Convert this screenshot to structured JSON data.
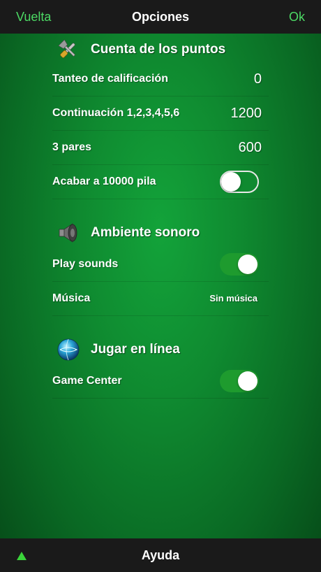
{
  "navbar": {
    "back_label": "Vuelta",
    "title": "Opciones",
    "ok_label": "Ok"
  },
  "sections": {
    "scoring": {
      "title": "Cuenta de los puntos",
      "icon": "tools-icon",
      "rows": [
        {
          "label": "Tanteo de calificación",
          "value": "0"
        },
        {
          "label": "Continuación 1,2,3,4,5,6",
          "value": "1200"
        },
        {
          "label": "3 pares",
          "value": "600"
        },
        {
          "label": "Acabar a 10000 pila",
          "toggle": false
        }
      ]
    },
    "sound": {
      "title": "Ambiente sonoro",
      "icon": "speaker-icon",
      "rows": [
        {
          "label": "Play sounds",
          "toggle": true
        },
        {
          "label": "Música",
          "value": "Sin música"
        }
      ]
    },
    "online": {
      "title": "Jugar en línea",
      "icon": "globe-icon",
      "rows": [
        {
          "label": "Game Center",
          "toggle": true
        }
      ]
    }
  },
  "bottombar": {
    "help_label": "Ayuda",
    "arrow_color": "#3ad43a"
  },
  "colors": {
    "accent": "#4cd964",
    "background": "#0f8a30",
    "bar": "#1a1a1a"
  }
}
